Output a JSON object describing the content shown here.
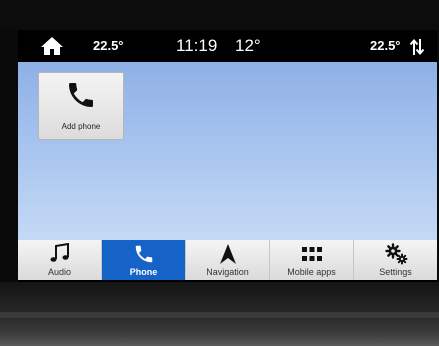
{
  "status_bar": {
    "home_icon": "home-icon",
    "driver_temp": "22.5°",
    "time": "11:19",
    "outside_temp": "12°",
    "passenger_temp": "22.5°",
    "sort_icon": "sort-arrows-icon"
  },
  "main": {
    "add_phone": {
      "label": "Add phone",
      "icon": "phone-handset-icon"
    }
  },
  "nav": {
    "items": [
      {
        "label": "Audio",
        "icon": "music-note-icon",
        "active": false
      },
      {
        "label": "Phone",
        "icon": "phone-handset-icon",
        "active": true
      },
      {
        "label": "Navigation",
        "icon": "navigation-arrow-icon",
        "active": false
      },
      {
        "label": "Mobile apps",
        "icon": "app-grid-icon",
        "active": false
      },
      {
        "label": "Settings",
        "icon": "gears-icon",
        "active": false
      }
    ]
  },
  "colors": {
    "active_tab": "#1663c7",
    "background_top": "#8fb0e6",
    "background_bottom": "#c4d9f5"
  }
}
